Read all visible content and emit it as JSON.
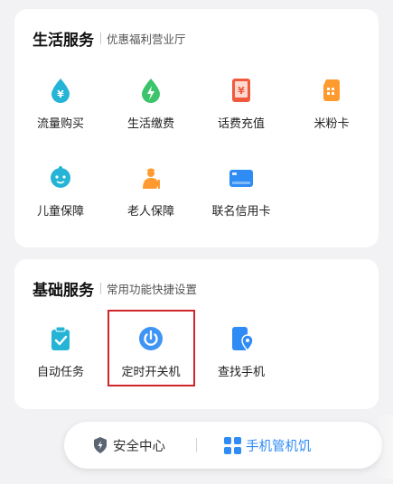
{
  "life_services": {
    "title": "生活服务",
    "subtitle": "优惠福利营业厅",
    "items": [
      {
        "label": "流量购买",
        "icon": "traffic-purchase-icon"
      },
      {
        "label": "生活缴费",
        "icon": "life-payment-icon"
      },
      {
        "label": "话费充值",
        "icon": "phone-recharge-icon"
      },
      {
        "label": "米粉卡",
        "icon": "mifen-card-icon"
      },
      {
        "label": "儿童保障",
        "icon": "child-protection-icon"
      },
      {
        "label": "老人保障",
        "icon": "elderly-protection-icon"
      },
      {
        "label": "联名信用卡",
        "icon": "cobrand-credit-card-icon"
      }
    ]
  },
  "basic_services": {
    "title": "基础服务",
    "subtitle": "常用功能快捷设置",
    "items": [
      {
        "label": "自动任务",
        "icon": "auto-task-icon"
      },
      {
        "label": "定时开关机",
        "icon": "scheduled-power-icon"
      },
      {
        "label": "查找手机",
        "icon": "find-phone-icon"
      }
    ]
  },
  "bottom_bar": {
    "security_label": "安全中心",
    "manager_label": "手机管机饥"
  },
  "colors": {
    "teal": "#25b4d6",
    "green": "#3cc46a",
    "red": "#f05a3c",
    "orange": "#ff9a2e",
    "blue": "#2f8cf5",
    "highlight": "#d0262b"
  }
}
